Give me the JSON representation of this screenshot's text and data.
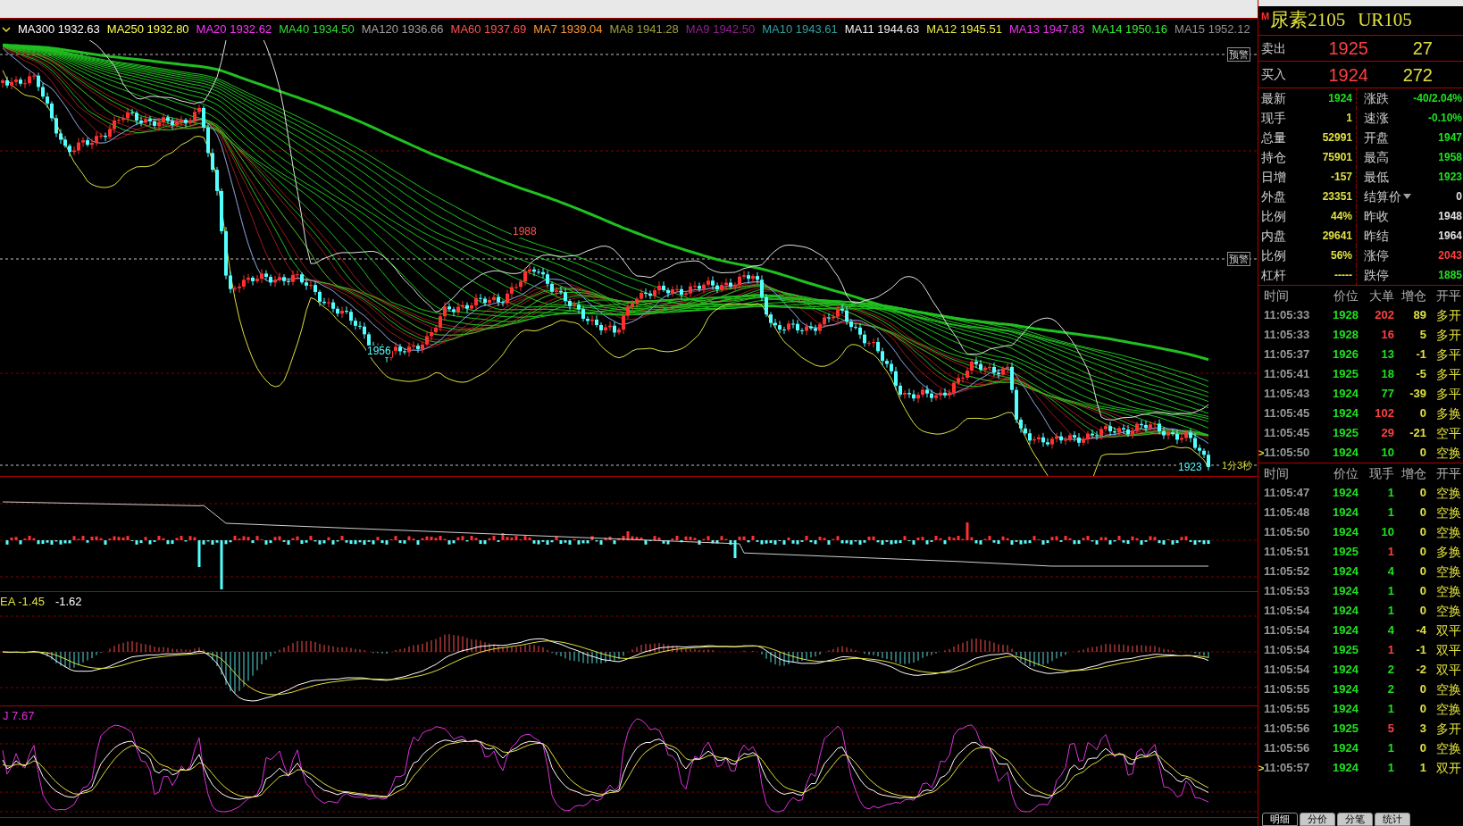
{
  "legend": [
    {
      "name": "MA300",
      "value": "1932.63",
      "color": "#ffffff"
    },
    {
      "name": "MA250",
      "value": "1932.80",
      "color": "#ffff54"
    },
    {
      "name": "MA20",
      "value": "1932.62",
      "color": "#ff33ff"
    },
    {
      "name": "MA40",
      "value": "1934.50",
      "color": "#33dd33"
    },
    {
      "name": "MA120",
      "value": "1936.66",
      "color": "#a0a0a0"
    },
    {
      "name": "MA60",
      "value": "1937.69",
      "color": "#ff5454"
    },
    {
      "name": "MA7",
      "value": "1939.04",
      "color": "#ff9933"
    },
    {
      "name": "MA8",
      "value": "1941.28",
      "color": "#a0a040"
    },
    {
      "name": "MA9",
      "value": "1942.50",
      "color": "#902090"
    },
    {
      "name": "MA10",
      "value": "1943.61",
      "color": "#30a0a0"
    },
    {
      "name": "MA11",
      "value": "1944.63",
      "color": "#f0f0f0"
    },
    {
      "name": "MA12",
      "value": "1945.51",
      "color": "#eeee44"
    },
    {
      "name": "MA13",
      "value": "1947.83",
      "color": "#ee33ee"
    },
    {
      "name": "MA14",
      "value": "1950.16",
      "color": "#33ee33"
    },
    {
      "name": "MA15",
      "value": "1952.12",
      "color": "#909090"
    }
  ],
  "price_pane": {
    "alert_labels": [
      "预警",
      "预警"
    ],
    "price_labels": [
      {
        "text": "1988",
        "color": "#ff5454"
      },
      {
        "text": "1956",
        "color": "#54ffff"
      },
      {
        "text": "1923",
        "color": "#54ffff"
      }
    ],
    "countdown": "1分3秒"
  },
  "macd_pane": {
    "legend": [
      {
        "text": "EA -1.45",
        "color": "#e0e040"
      },
      {
        "text": "-1.62",
        "color": "#ffffff"
      }
    ]
  },
  "kdj_pane": {
    "legend": [
      {
        "text": "J 7.67",
        "color": "#dd33dd"
      }
    ]
  },
  "quote": {
    "badge": "M",
    "name": "尿素2105",
    "code": "UR105",
    "ask": {
      "label": "卖出",
      "price": "1925",
      "volume": "27"
    },
    "bid": {
      "label": "买入",
      "price": "1924",
      "volume": "272"
    },
    "stats": [
      [
        {
          "label": "最新",
          "value": "1924",
          "color": "#20e020"
        },
        {
          "label": "涨跌",
          "value": "-40/2.04%",
          "color": "#20e020",
          "dropdown": false
        }
      ],
      [
        {
          "label": "现手",
          "value": "1",
          "color": "#e0e040"
        },
        {
          "label": "速涨",
          "value": "-0.10%",
          "color": "#20e020",
          "dropdown": false
        }
      ],
      [
        {
          "label": "总量",
          "value": "52991",
          "color": "#e0e040"
        },
        {
          "label": "开盘",
          "value": "1947",
          "color": "#20e020",
          "dropdown": false
        }
      ],
      [
        {
          "label": "持仓",
          "value": "75901",
          "color": "#e0e040"
        },
        {
          "label": "最高",
          "value": "1958",
          "color": "#20e020",
          "dropdown": false
        }
      ],
      [
        {
          "label": "日增",
          "value": "-157",
          "color": "#e0e040"
        },
        {
          "label": "最低",
          "value": "1923",
          "color": "#20e020",
          "dropdown": false
        }
      ],
      [
        {
          "label": "外盘",
          "value": "23351",
          "color": "#e0e040"
        },
        {
          "label": "结算价",
          "value": "0",
          "color": "#e0e0e0",
          "dropdown": true
        }
      ],
      [
        {
          "label": "比例",
          "value": "44%",
          "color": "#e0e040"
        },
        {
          "label": "昨收",
          "value": "1948",
          "color": "#e0e0e0",
          "dropdown": false
        }
      ],
      [
        {
          "label": "内盘",
          "value": "29641",
          "color": "#e0e040"
        },
        {
          "label": "昨结",
          "value": "1964",
          "color": "#e0e0e0",
          "dropdown": false
        }
      ],
      [
        {
          "label": "比例",
          "value": "56%",
          "color": "#e0e040"
        },
        {
          "label": "涨停",
          "value": "2043",
          "color": "#ff4040",
          "dropdown": false
        }
      ],
      [
        {
          "label": "杠杆",
          "value": "-----",
          "color": "#e0e040"
        },
        {
          "label": "跌停",
          "value": "1885",
          "color": "#20e020",
          "dropdown": false
        }
      ]
    ]
  },
  "big_orders": {
    "columns": [
      "时间",
      "价位",
      "大单",
      "增仓",
      "开平"
    ],
    "rows": [
      {
        "time": "11:05:33",
        "price": "1928",
        "qty": "202",
        "color": "#ff4040",
        "change": "89",
        "type": "多开"
      },
      {
        "time": "11:05:33",
        "price": "1928",
        "qty": "16",
        "color": "#ff4040",
        "change": "5",
        "type": "多开"
      },
      {
        "time": "11:05:37",
        "price": "1926",
        "qty": "13",
        "color": "#20e020",
        "change": "-1",
        "type": "多平"
      },
      {
        "time": "11:05:41",
        "price": "1925",
        "qty": "18",
        "color": "#20e020",
        "change": "-5",
        "type": "多平"
      },
      {
        "time": "11:05:43",
        "price": "1924",
        "qty": "77",
        "color": "#20e020",
        "change": "-39",
        "type": "多平"
      },
      {
        "time": "11:05:45",
        "price": "1924",
        "qty": "102",
        "color": "#ff4040",
        "change": "0",
        "type": "多换"
      },
      {
        "time": "11:05:45",
        "price": "1925",
        "qty": "29",
        "color": "#ff4040",
        "change": "-21",
        "type": "空平"
      },
      {
        "time": "11:05:50",
        "price": "1924",
        "qty": "10",
        "color": "#20e020",
        "change": "0",
        "type": "空换",
        "marker": ">"
      }
    ]
  },
  "ticks": {
    "columns": [
      "时间",
      "价位",
      "现手",
      "增仓",
      "开平"
    ],
    "rows": [
      {
        "time": "11:05:47",
        "price": "1924",
        "qty": "1",
        "color": "#20e020",
        "change": "0",
        "type": "空换"
      },
      {
        "time": "11:05:48",
        "price": "1924",
        "qty": "1",
        "color": "#20e020",
        "change": "0",
        "type": "空换"
      },
      {
        "time": "11:05:50",
        "price": "1924",
        "qty": "10",
        "color": "#20e020",
        "change": "0",
        "type": "空换"
      },
      {
        "time": "11:05:51",
        "price": "1925",
        "qty": "1",
        "color": "#ff4040",
        "change": "0",
        "type": "多换"
      },
      {
        "time": "11:05:52",
        "price": "1924",
        "qty": "4",
        "color": "#20e020",
        "change": "0",
        "type": "空换"
      },
      {
        "time": "11:05:53",
        "price": "1924",
        "qty": "1",
        "color": "#20e020",
        "change": "0",
        "type": "空换"
      },
      {
        "time": "11:05:54",
        "price": "1924",
        "qty": "1",
        "color": "#20e020",
        "change": "0",
        "type": "空换"
      },
      {
        "time": "11:05:54",
        "price": "1924",
        "qty": "4",
        "color": "#20e020",
        "change": "-4",
        "type": "双平"
      },
      {
        "time": "11:05:54",
        "price": "1925",
        "qty": "1",
        "color": "#ff4040",
        "change": "-1",
        "type": "双平"
      },
      {
        "time": "11:05:54",
        "price": "1924",
        "qty": "2",
        "color": "#20e020",
        "change": "-2",
        "type": "双平"
      },
      {
        "time": "11:05:55",
        "price": "1924",
        "qty": "2",
        "color": "#20e020",
        "change": "0",
        "type": "空换"
      },
      {
        "time": "11:05:55",
        "price": "1924",
        "qty": "1",
        "color": "#20e020",
        "change": "0",
        "type": "空换"
      },
      {
        "time": "11:05:56",
        "price": "1925",
        "qty": "5",
        "color": "#ff4040",
        "change": "3",
        "type": "多开"
      },
      {
        "time": "11:05:56",
        "price": "1924",
        "qty": "1",
        "color": "#20e020",
        "change": "0",
        "type": "空换"
      },
      {
        "time": "11:05:57",
        "price": "1924",
        "qty": "1",
        "color": "#20e020",
        "change": "1",
        "type": "双开",
        "marker": ">"
      }
    ]
  },
  "tabs": [
    {
      "label": "明细",
      "selected": true
    },
    {
      "label": "分价",
      "selected": false
    },
    {
      "label": "分笔",
      "selected": false
    },
    {
      "label": "统计",
      "selected": false
    }
  ]
}
